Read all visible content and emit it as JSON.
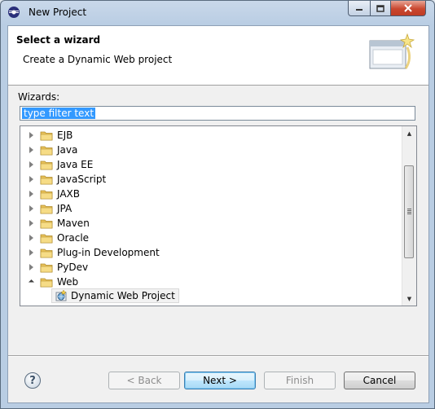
{
  "window": {
    "title": "New Project"
  },
  "header": {
    "title": "Select a wizard",
    "description": "Create a Dynamic Web project"
  },
  "wizards_label": "Wizards:",
  "filter": {
    "value": "type filter text"
  },
  "tree": {
    "folders": [
      "EJB",
      "Java",
      "Java EE",
      "JavaScript",
      "JAXB",
      "JPA",
      "Maven",
      "Oracle",
      "Plug-in Development",
      "PyDev",
      "Web"
    ],
    "expanded": "Web",
    "selected_child": "Dynamic Web Project"
  },
  "buttons": {
    "back": "< Back",
    "next": "Next >",
    "finish": "Finish",
    "cancel": "Cancel",
    "help": "?"
  },
  "colors": {
    "selection": "#3399ff",
    "folder": "#e8c25a"
  }
}
